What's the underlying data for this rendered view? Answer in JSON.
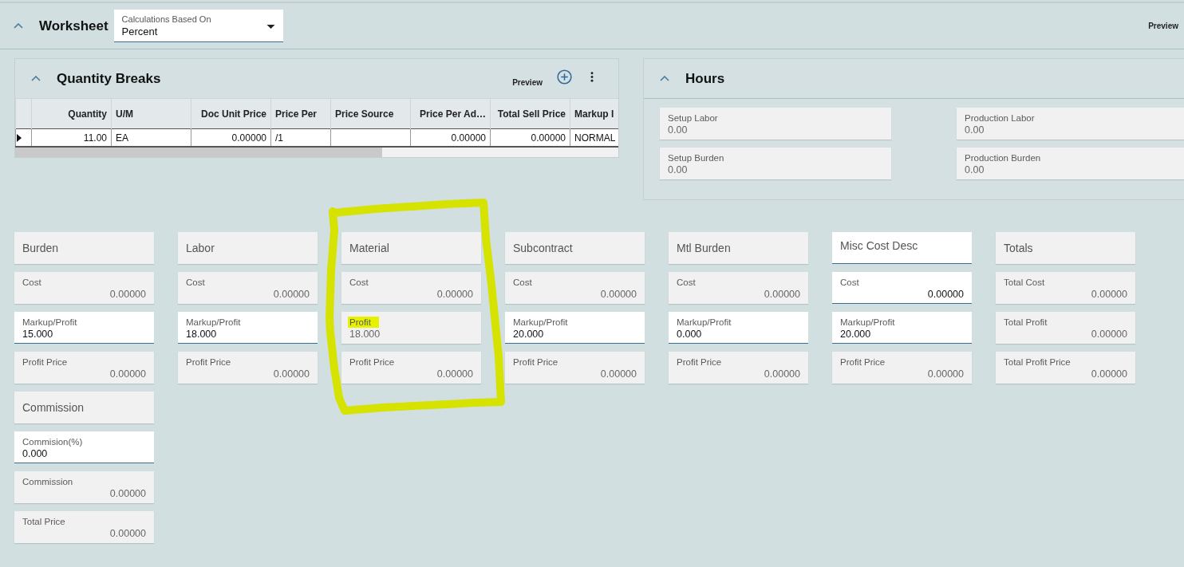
{
  "header": {
    "title": "Worksheet",
    "expanded": true,
    "calc_field": {
      "label": "Calculations Based On",
      "value": "Percent"
    },
    "action": "Preview"
  },
  "quantity_breaks": {
    "title": "Quantity Breaks",
    "expanded": true,
    "action": "Preview",
    "columns": [
      {
        "label": "Quantity",
        "kind": "number"
      },
      {
        "label": "U/M",
        "kind": "text"
      },
      {
        "label": "Doc Unit Price",
        "kind": "number"
      },
      {
        "label": "Price Per",
        "kind": "text"
      },
      {
        "label": "Price Source",
        "kind": "text"
      },
      {
        "label": "Price Per Ad…",
        "kind": "number"
      },
      {
        "label": "Total Sell Price",
        "kind": "number"
      },
      {
        "label": "Markup I",
        "kind": "text"
      }
    ],
    "rows": [
      {
        "selected": true,
        "cells": [
          "11.00",
          "EA",
          "0.00000",
          "/1",
          null,
          "0.00000",
          "0.00000",
          "NORMAL"
        ]
      }
    ]
  },
  "hours": {
    "title": "Hours",
    "expanded": true,
    "fields": [
      {
        "label": "Setup Labor",
        "value": "0.00"
      },
      {
        "label": "Production Labor",
        "value": "0.00"
      },
      {
        "label": "Setup Burden",
        "value": "0.00"
      },
      {
        "label": "Production Burden",
        "value": "0.00"
      }
    ]
  },
  "cost_columns": [
    {
      "groups": [
        {
          "title": "Burden",
          "title_editable": false,
          "circled": false,
          "fields": [
            {
              "label": "Cost",
              "value": "0.00000",
              "kind": "amount",
              "editable": false,
              "highlighted": false
            },
            {
              "label": "Markup/Profit",
              "value": "15.000",
              "kind": "percent",
              "editable": true,
              "highlighted": false
            },
            {
              "label": "Profit Price",
              "value": "0.00000",
              "kind": "amount",
              "editable": false,
              "highlighted": false
            }
          ]
        },
        {
          "title": "Commission",
          "title_editable": false,
          "circled": false,
          "fields": [
            {
              "label": "Commision(%)",
              "value": "0.000",
              "kind": "percent",
              "editable": true,
              "highlighted": false
            },
            {
              "label": "Commission",
              "value": "0.00000",
              "kind": "amount",
              "editable": false,
              "highlighted": false
            },
            {
              "label": "Total Price",
              "value": "0.00000",
              "kind": "amount",
              "editable": false,
              "highlighted": false
            }
          ]
        }
      ]
    },
    {
      "groups": [
        {
          "title": "Labor",
          "title_editable": false,
          "circled": false,
          "fields": [
            {
              "label": "Cost",
              "value": "0.00000",
              "kind": "amount",
              "editable": false,
              "highlighted": false
            },
            {
              "label": "Markup/Profit",
              "value": "18.000",
              "kind": "percent",
              "editable": true,
              "highlighted": false
            },
            {
              "label": "Profit Price",
              "value": "0.00000",
              "kind": "amount",
              "editable": false,
              "highlighted": false
            }
          ]
        }
      ]
    },
    {
      "groups": [
        {
          "title": "Material",
          "title_editable": false,
          "circled": true,
          "fields": [
            {
              "label": "Cost",
              "value": "0.00000",
              "kind": "amount",
              "editable": false,
              "highlighted": false
            },
            {
              "label": "Profit",
              "value": "18.000",
              "kind": "percent",
              "editable": false,
              "highlighted": true
            },
            {
              "label": "Profit Price",
              "value": "0.00000",
              "kind": "amount",
              "editable": false,
              "highlighted": false
            }
          ]
        }
      ]
    },
    {
      "groups": [
        {
          "title": "Subcontract",
          "title_editable": false,
          "circled": false,
          "fields": [
            {
              "label": "Cost",
              "value": "0.00000",
              "kind": "amount",
              "editable": false,
              "highlighted": false
            },
            {
              "label": "Markup/Profit",
              "value": "20.000",
              "kind": "percent",
              "editable": true,
              "highlighted": false
            },
            {
              "label": "Profit Price",
              "value": "0.00000",
              "kind": "amount",
              "editable": false,
              "highlighted": false
            }
          ]
        }
      ]
    },
    {
      "groups": [
        {
          "title": "Mtl Burden",
          "title_editable": false,
          "circled": false,
          "fields": [
            {
              "label": "Cost",
              "value": "0.00000",
              "kind": "amount",
              "editable": false,
              "highlighted": false
            },
            {
              "label": "Markup/Profit",
              "value": "0.000",
              "kind": "percent",
              "editable": true,
              "highlighted": false
            },
            {
              "label": "Profit Price",
              "value": "0.00000",
              "kind": "amount",
              "editable": false,
              "highlighted": false
            }
          ]
        }
      ]
    },
    {
      "groups": [
        {
          "title": "Misc Cost Desc",
          "title_editable": true,
          "circled": false,
          "fields": [
            {
              "label": "Cost",
              "value": "0.00000",
              "kind": "amount",
              "editable": true,
              "highlighted": false
            },
            {
              "label": "Markup/Profit",
              "value": "20.000",
              "kind": "percent",
              "editable": true,
              "highlighted": false
            },
            {
              "label": "Profit Price",
              "value": "0.00000",
              "kind": "amount",
              "editable": false,
              "highlighted": false
            }
          ]
        }
      ]
    },
    {
      "groups": [
        {
          "title": "Totals",
          "title_editable": false,
          "circled": false,
          "fields": [
            {
              "label": "Total Cost",
              "value": "0.00000",
              "kind": "amount",
              "editable": false,
              "highlighted": false
            },
            {
              "label": "Total Profit",
              "value": "0.00000",
              "kind": "amount",
              "editable": false,
              "highlighted": false
            },
            {
              "label": "Total Profit Price",
              "value": "0.00000",
              "kind": "amount",
              "editable": false,
              "highlighted": false
            }
          ]
        }
      ]
    }
  ]
}
